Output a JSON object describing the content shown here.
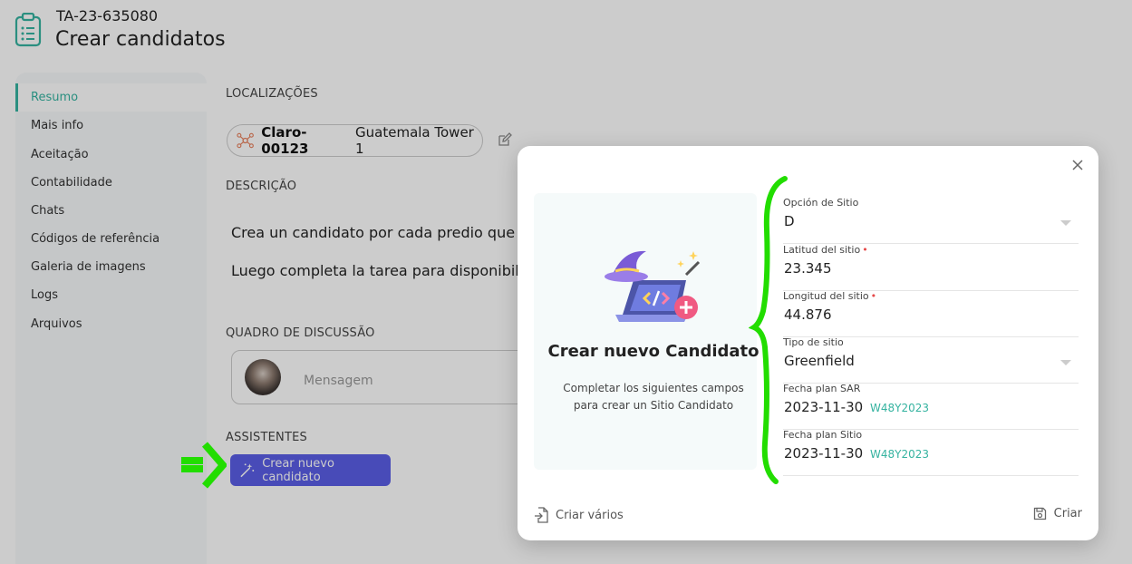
{
  "header": {
    "ticket_id": "TA-23-635080",
    "title": "Crear candidatos"
  },
  "sidebar": {
    "items": [
      {
        "label": "Resumo",
        "active": true
      },
      {
        "label": "Mais info"
      },
      {
        "label": "Aceitação"
      },
      {
        "label": "Contabilidade"
      },
      {
        "label": "Chats"
      },
      {
        "label": "Códigos de referência"
      },
      {
        "label": "Galeria de imagens"
      },
      {
        "label": "Logs"
      },
      {
        "label": "Arquivos"
      }
    ]
  },
  "main": {
    "locations_label": "LOCALIZAÇÕES",
    "location_code": "Claro-00123",
    "location_name": "Guatemala Tower 1",
    "description_label": "DESCRIÇÃO",
    "description_line1": "Crea un candidato por cada predio que v",
    "description_line2": "Luego completa la tarea para disponibili",
    "discussion_label": "QUADRO DE DISCUSSÃO",
    "message_placeholder": "Mensagem",
    "assistants_label": "ASSISTENTES",
    "wizard_button": "Crear nuevo candidato"
  },
  "modal": {
    "heading": "Crear nuevo Candidato",
    "subtitle": "Completar los siguientes campos para crear un Sitio Candidato",
    "fields": [
      {
        "label": "Opción de Sitio",
        "value": "D",
        "required": false,
        "dropdown": true
      },
      {
        "label": "Latitud del sitio",
        "value": "23.345",
        "required": true
      },
      {
        "label": "Longitud del sitio",
        "value": "44.876",
        "required": true
      },
      {
        "label": "Tipo de sitio",
        "value": "Greenfield",
        "required": false,
        "dropdown": true
      },
      {
        "label": "Fecha plan SAR",
        "value": "2023-11-30",
        "week": "W48Y2023"
      },
      {
        "label": "Fecha plan Sitio",
        "value": "2023-11-30",
        "week": "W48Y2023"
      }
    ],
    "required_mark": "•",
    "create_many": "Criar vários",
    "create": "Criar"
  },
  "colors": {
    "accent": "#35b3a0",
    "button": "#5a5ee6",
    "annotation": "#22dd00"
  }
}
